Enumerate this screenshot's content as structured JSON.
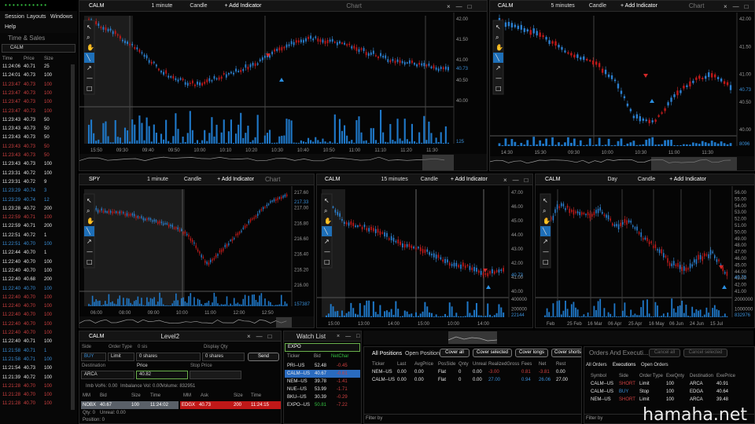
{
  "menu": [
    "Session",
    "Layouts",
    "Windows",
    "Help"
  ],
  "ts": {
    "title": "Time & Sales",
    "symbol": "CALM",
    "cols": [
      "Time",
      "Price",
      "Size"
    ],
    "rows": [
      [
        "11:24:06",
        "40.71",
        "25",
        "w"
      ],
      [
        "11:24:01",
        "40.73",
        "100",
        "w"
      ],
      [
        "11:23:47",
        "40.73",
        "100",
        "r"
      ],
      [
        "11:23:47",
        "40.73",
        "100",
        "r"
      ],
      [
        "11:23:47",
        "40.73",
        "100",
        "r"
      ],
      [
        "11:23:47",
        "40.73",
        "100",
        "r"
      ],
      [
        "11:23:43",
        "40.73",
        "50",
        "w"
      ],
      [
        "11:23:43",
        "40.73",
        "50",
        "w"
      ],
      [
        "11:23:43",
        "40.73",
        "50",
        "w"
      ],
      [
        "11:23:43",
        "40.73",
        "50",
        "r"
      ],
      [
        "11:23:43",
        "40.73",
        "50",
        "r"
      ],
      [
        "11:23:43",
        "40.73",
        "100",
        "w"
      ],
      [
        "11:23:31",
        "40.72",
        "100",
        "w"
      ],
      [
        "11:23:31",
        "40.72",
        "9",
        "w"
      ],
      [
        "11:23:29",
        "40.74",
        "3",
        "b"
      ],
      [
        "11:23:29",
        "40.74",
        "12",
        "b"
      ],
      [
        "11:23:28",
        "40.72",
        "200",
        "w"
      ],
      [
        "11:22:59",
        "40.71",
        "100",
        "r"
      ],
      [
        "11:22:59",
        "40.71",
        "200",
        "w"
      ],
      [
        "11:22:51",
        "40.72",
        "1",
        "w"
      ],
      [
        "11:22:51",
        "40.70",
        "100",
        "b"
      ],
      [
        "11:22:44",
        "40.70",
        "1",
        "w"
      ],
      [
        "11:22:40",
        "40.70",
        "100",
        "w"
      ],
      [
        "11:22:40",
        "40.70",
        "100",
        "w"
      ],
      [
        "11:22:40",
        "40.68",
        "200",
        "w"
      ],
      [
        "11:22:40",
        "40.70",
        "100",
        "b"
      ],
      [
        "11:22:40",
        "40.70",
        "100",
        "r"
      ],
      [
        "11:22:40",
        "40.70",
        "100",
        "r"
      ],
      [
        "11:22:40",
        "40.70",
        "100",
        "r"
      ],
      [
        "11:22:40",
        "40.70",
        "100",
        "r"
      ],
      [
        "11:22:40",
        "40.70",
        "100",
        "r"
      ],
      [
        "11:22:40",
        "40.71",
        "100",
        "w"
      ],
      [
        "11:21:58",
        "40.71",
        "1",
        "b"
      ],
      [
        "11:21:58",
        "40.71",
        "100",
        "b"
      ],
      [
        "11:21:54",
        "40.73",
        "100",
        "w"
      ],
      [
        "11:21:39",
        "40.72",
        "100",
        "w"
      ],
      [
        "11:21:28",
        "40.70",
        "100",
        "r"
      ],
      [
        "11:21:28",
        "40.70",
        "100",
        "r"
      ],
      [
        "11:21:28",
        "40.70",
        "100",
        "r"
      ]
    ]
  },
  "charts": {
    "add": "+ Add Indicator",
    "chartLabel": "Chart",
    "candle": "Candle",
    "c1": {
      "sym": "CALM",
      "tf": "1 minute",
      "y": [
        "42.00",
        "41.50",
        "41.00",
        "40.50",
        "40.00"
      ],
      "last": "40.73",
      "vol": "125",
      "x": [
        "15:50",
        "09:30",
        "09:40",
        "09:50",
        "10:00",
        "10:10",
        "10:20",
        "10:30",
        "10:40",
        "10:50",
        "11:00",
        "11:10",
        "11:20",
        "11:30"
      ]
    },
    "c2": {
      "sym": "CALM",
      "tf": "5 minutes",
      "y": [
        "42.00",
        "41.50",
        "41.00",
        "40.50",
        "40.00"
      ],
      "last": "40.73",
      "vol": "8096",
      "x": [
        "14:30",
        "15:30",
        "09:30",
        "10:00",
        "10:30",
        "11:00",
        "11:30"
      ]
    },
    "c3": {
      "sym": "SPY",
      "tf": "1 minute",
      "y": [
        "217.60",
        "217.00",
        "216.80",
        "216.60",
        "216.40",
        "216.20",
        "216.00"
      ],
      "last": "217.33",
      "vol": "157387",
      "x": [
        "06:00",
        "08:00",
        "09:00",
        "10:00",
        "11:00",
        "12:00",
        "12:50"
      ]
    },
    "c4": {
      "sym": "CALM",
      "tf": "15 minutes",
      "y": [
        "47.00",
        "46.00",
        "45.00",
        "44.00",
        "43.00",
        "42.00",
        "41.00",
        "40.00",
        "400000",
        "200000"
      ],
      "last": "40.73",
      "vol": "22144",
      "x": [
        "15:00",
        "13:00",
        "14:00",
        "15:00",
        "10:00",
        "14:00"
      ]
    },
    "c5": {
      "sym": "CALM",
      "tf": "Day",
      "y": [
        "56.00",
        "55.00",
        "54.00",
        "53.00",
        "52.00",
        "51.00",
        "50.00",
        "49.00",
        "48.00",
        "47.00",
        "46.00",
        "45.00",
        "44.00",
        "43.00",
        "42.00",
        "41.00",
        "2000000",
        "1000000"
      ],
      "last": "40.73",
      "vol": "832976",
      "x": [
        "Feb",
        "25 Feb",
        "16 Mar",
        "06 Apr",
        "25 Apr",
        "16 May",
        "06 Jun",
        "24 Jun",
        "15 Jul"
      ]
    }
  },
  "l2": {
    "sym": "CALM",
    "title": "Level2",
    "side": "BUY",
    "otype": "Limit",
    "qty": "0 shares",
    "dqty": "0 shares",
    "dest": "ARCA",
    "price": "40.82",
    "send": "Send",
    "imb": "Imb Vol%: 0.00",
    "imbvol": "Imbalance Vol: 0.00",
    "volume": "Volume: 832951",
    "l": {
      "side": "Side",
      "otype": "Order Type",
      "qty": "0 sis",
      "dqty": "Display Qty",
      "dest": "Destination",
      "price": "Price",
      "stop": "Stop Price"
    },
    "cols": [
      "MM",
      "Bid",
      "Size",
      "Time",
      "MM",
      "Ask",
      "Size",
      "Time"
    ],
    "bid": [
      "NOBX",
      "40.67",
      "100",
      "11:24:02"
    ],
    "ask": [
      "EDGX",
      "40.73",
      "200",
      "11:24:15"
    ],
    "qty2": "Qty: 0",
    "unreal": "Unreal: 0.00",
    "pos": "Position: 0"
  },
  "wl": {
    "title": "Watch List",
    "input": "EXPO",
    "cols": [
      "Ticker",
      "Bid",
      "NetChar"
    ],
    "rows": [
      [
        "PRI--US",
        "52.48",
        "-0.45"
      ],
      [
        "CALM--US",
        "40.67",
        "-0.61"
      ],
      [
        "NEM--US",
        "39.78",
        "-1.41"
      ],
      [
        "NUE--US",
        "53.99",
        "-1.71"
      ],
      [
        "BKU--US",
        "30.39",
        "-0.29"
      ],
      [
        "EXPO--US",
        "50.81",
        "-7.22"
      ]
    ]
  },
  "pos": {
    "tabs": [
      "All Positions",
      "Open Positions"
    ],
    "btns": [
      "Cover all",
      "Cover selected",
      "Cover longs",
      "Cover shorts"
    ],
    "cols": [
      "Ticker",
      "Last",
      "AvgPrice",
      "PosSide",
      "Qnty",
      "Unreal",
      "RealizedGross",
      "Fees",
      "Net",
      "Rest"
    ],
    "rows": [
      [
        "NEM--US",
        "0.00",
        "0.00",
        "Flat",
        "0",
        "0.00",
        "-3.00",
        "0.81",
        "-3.81",
        "0.00"
      ],
      [
        "CALM--US",
        "0.00",
        "0.00",
        "Flat",
        "0",
        "0.00",
        "27.00",
        "0.94",
        "26.06",
        "27.00"
      ]
    ],
    "filter": "Filter by"
  },
  "oe": {
    "title": "Orders And Executi...",
    "b1": "Cancel all",
    "b2": "Cancel selected",
    "tabs": [
      "All Orders",
      "Executions",
      "Open Orders"
    ],
    "cols": [
      "Symbol",
      "Side",
      "Order Type",
      "ExeQnty",
      "Destination",
      "ExePrice"
    ],
    "rows": [
      [
        "CALM--US",
        "SHORT",
        "Limit",
        "100",
        "ARCA",
        "40.91"
      ],
      [
        "CALM--US",
        "BUY",
        "Stop",
        "100",
        "EDGA",
        "40.64"
      ],
      [
        "NEM--US",
        "SHORT",
        "Limit",
        "100",
        "ARCA",
        "39.48"
      ]
    ],
    "filter": "Filter by"
  },
  "watermark": "hamaha.net"
}
